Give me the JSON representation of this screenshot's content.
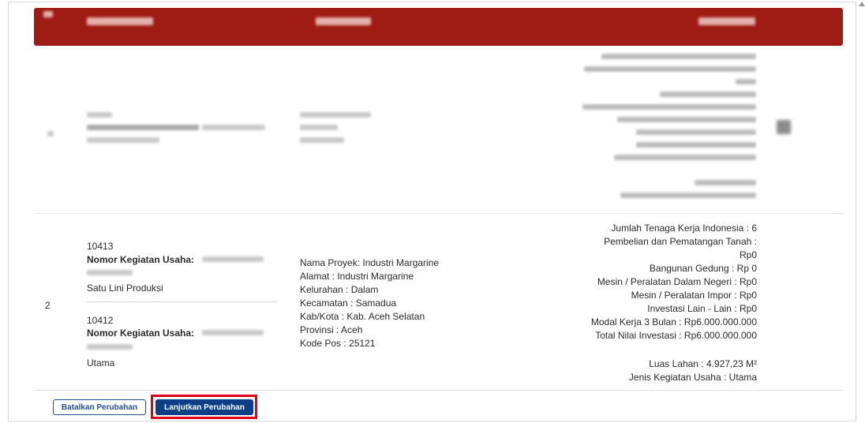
{
  "row2": {
    "number": "2",
    "bidang": {
      "kbli1": "10413",
      "nomor_label1": "Nomor Kegiatan Usaha:",
      "desc1": "Satu Lini Produksi",
      "kbli2": "10412",
      "nomor_label2": "Nomor Kegiatan Usaha:",
      "desc2": "Utama"
    },
    "lokasi": [
      "Nama Proyek: Industri Margarine",
      "Alamat : Industri Margarine",
      "Kelurahan : Dalam",
      "Kecamatan : Samadua",
      "Kab/Kota : Kab. Aceh Selatan",
      "Provinsi : Aceh",
      "Kode Pos : 25121"
    ],
    "detail": [
      "Jumlah Tenaga Kerja Indonesia : 6",
      "Pembelian dan Pematangan Tanah :",
      "Rp0",
      "Bangunan Gedung : Rp 0",
      "Mesin / Peralatan Dalam Negeri : Rp0",
      "Mesin / Peralatan Impor : Rp0",
      "Investasi Lain - Lain : Rp0",
      "Modal Kerja 3 Bulan : Rp6.000.000.000",
      "Total Nilai Investasi : Rp6.000.000.000"
    ],
    "detail_extra": [
      "Luas Lahan : 4.927,23 M²",
      "Jenis Kegiatan Usaha : Utama"
    ]
  },
  "buttons": {
    "cancel_label": "Batalkan Perubahan",
    "continue_label": "Lanjutkan Perubahan"
  },
  "colors": {
    "header": "#9e1c14",
    "primary": "#0d3f86",
    "highlight": "#e0001a"
  },
  "icons": {
    "edit": "edit-icon"
  }
}
